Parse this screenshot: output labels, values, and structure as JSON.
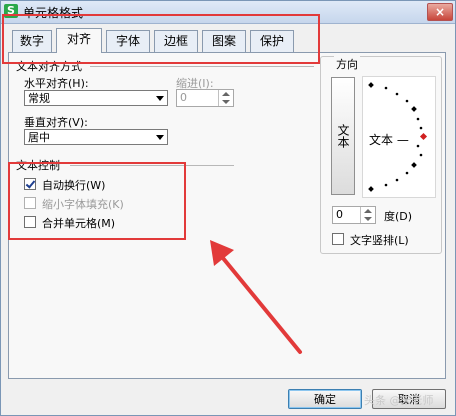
{
  "window": {
    "title": "单元格格式",
    "app_icon": "S",
    "close": "×"
  },
  "tabs": [
    {
      "label": "数字",
      "active": false
    },
    {
      "label": "对齐",
      "active": true
    },
    {
      "label": "字体",
      "active": false
    },
    {
      "label": "边框",
      "active": false
    },
    {
      "label": "图案",
      "active": false
    },
    {
      "label": "保护",
      "active": false
    }
  ],
  "alignment": {
    "group_title": "文本对齐方式",
    "horizontal_label": "水平对齐(H):",
    "horizontal_value": "常规",
    "indent_label": "缩进(I):",
    "indent_value": "0",
    "vertical_label": "垂直对齐(V):",
    "vertical_value": "居中"
  },
  "text_control": {
    "group_title": "文本控制",
    "wrap_label": "自动换行(W)",
    "wrap_checked": true,
    "shrink_label": "缩小字体填充(K)",
    "shrink_checked": false,
    "merge_label": "合并单元格(M)",
    "merge_checked": false
  },
  "orientation": {
    "group_title": "方向",
    "vertical_text": "文本",
    "horizontal_text": "文本 —",
    "degree_value": "0",
    "degree_label": "度(D)",
    "vertical_layout_label": "文字竖排(L)"
  },
  "buttons": {
    "ok": "确定",
    "cancel": "取消"
  },
  "watermark": "头条 @宋老师"
}
